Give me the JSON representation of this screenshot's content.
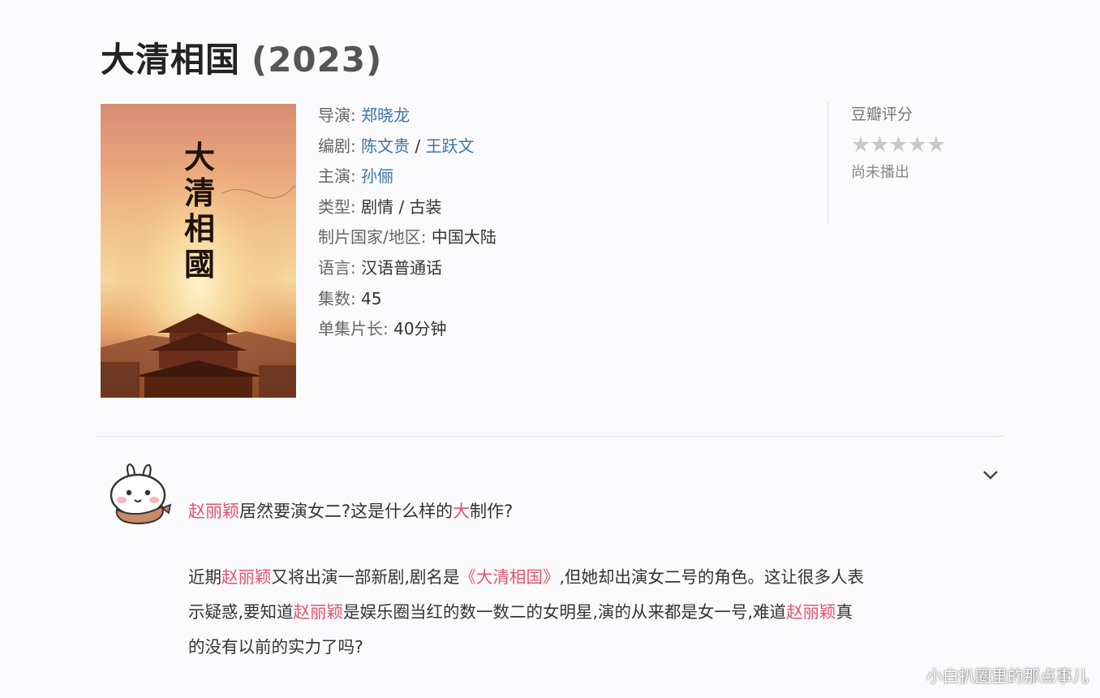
{
  "title": {
    "text": "大清相国",
    "year": "(2023)"
  },
  "poster": {
    "title_chars": [
      "大",
      "清",
      "相",
      "國"
    ],
    "colors": {
      "sky_top": "#d88d73",
      "sun": "#f4d7a0",
      "palace": "#6b2e1a"
    }
  },
  "info": {
    "director": {
      "label": "导演:",
      "value": "郑晓龙"
    },
    "writers": {
      "label": "编剧:",
      "value1": "陈文贵",
      "sep": " / ",
      "value2": "王跃文"
    },
    "cast": {
      "label": "主演:",
      "value": "孙俪"
    },
    "genre": {
      "label": "类型:",
      "value": "剧情 / 古装"
    },
    "region": {
      "label": "制片国家/地区:",
      "value": "中国大陆"
    },
    "language": {
      "label": "语言:",
      "value": "汉语普通话"
    },
    "episodes": {
      "label": "集数:",
      "value": "45"
    },
    "runtime": {
      "label": "单集片长:",
      "value": "40分钟"
    }
  },
  "rating": {
    "title": "豆瓣评分",
    "stars": "★★★★★",
    "status": "尚未播出",
    "star_color": "#c9c9cc"
  },
  "post": {
    "avatar_icon": "cartoon-bunny-avatar-icon",
    "chevron_icon": "chevron-down-icon",
    "headline": {
      "name": "赵丽颖",
      "part1": "居然要演女二?这是什么样的",
      "big": "大",
      "part2": "制作?"
    },
    "paragraph": {
      "l1_a": "近期",
      "l1_name": "赵丽颖",
      "l1_b": "又将出演一部新剧,剧名是",
      "l1_title": "《大清相国》",
      "l1_c": ",但她却出演女二号的角色。这让很多人表",
      "l2_a": "示疑惑,要知道",
      "l2_name": "赵丽颖",
      "l2_b": "是娱乐圈当红的数一数二的女明星,演的从来都是女一号,难道",
      "l2_name2": "赵丽颖",
      "l2_c": "真",
      "l3": "的没有以前的实力了吗?"
    },
    "highlight_color": "#e0566b"
  },
  "watermark": "小白扒圈里的那点事儿",
  "colors": {
    "link": "#3d73a8",
    "label": "#666666",
    "background": "#fbfbfd"
  }
}
